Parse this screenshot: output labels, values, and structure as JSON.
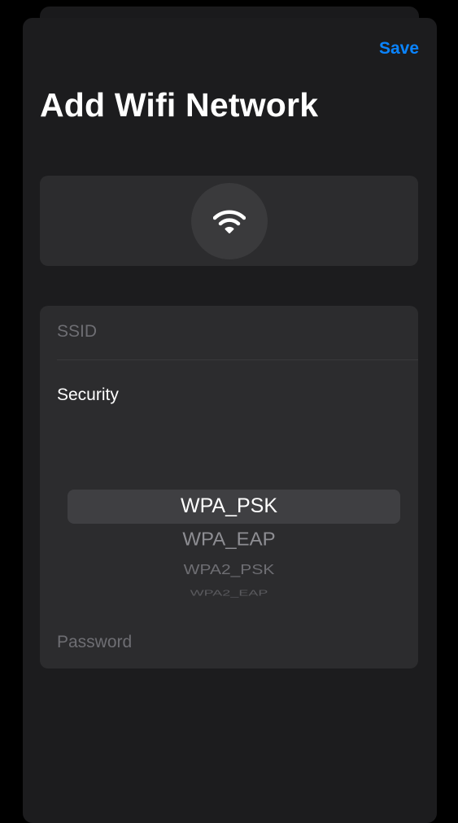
{
  "header": {
    "save_label": "Save",
    "title": "Add Wifi Network"
  },
  "hero": {
    "icon": "wifi-icon"
  },
  "form": {
    "ssid_placeholder": "SSID",
    "security_label": "Security",
    "security_options": [
      "WPA_PSK",
      "WPA_EAP",
      "WPA2_PSK",
      "WPA2_EAP"
    ],
    "security_selected": "WPA_PSK",
    "password_placeholder": "Password"
  },
  "colors": {
    "accent": "#0a84ff",
    "background": "#000000",
    "sheet": "#1c1c1e",
    "card": "#2c2c2e"
  }
}
